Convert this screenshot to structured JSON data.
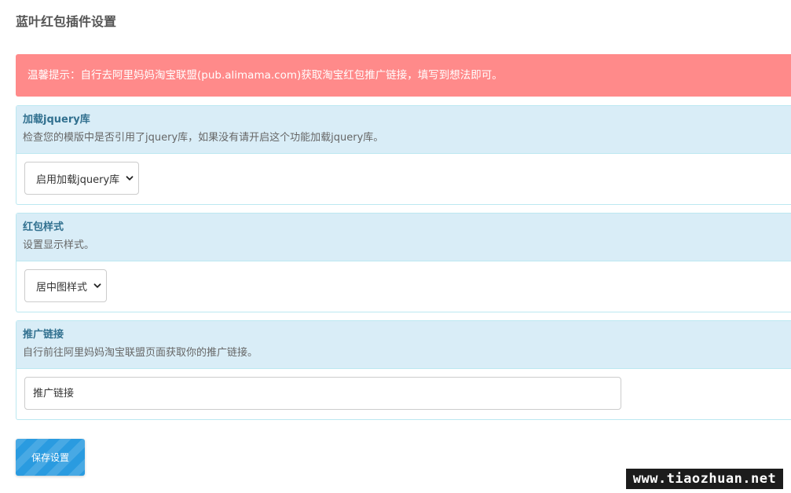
{
  "page": {
    "title": "蓝叶红包插件设置"
  },
  "alert": {
    "text": "温馨提示：自行去阿里妈妈淘宝联盟(pub.alimama.com)获取淘宝红包推广链接，填写到想法即可。"
  },
  "sections": [
    {
      "title": "加载jquery库",
      "description": "检查您的模版中是否引用了jquery库，如果没有请开启这个功能加载jquery库。",
      "control": "select",
      "selected": "启用加载jquery库"
    },
    {
      "title": "红包样式",
      "description": "设置显示样式。",
      "control": "select",
      "selected": "居中图样式"
    },
    {
      "title": "推广链接",
      "description": "自行前往阿里妈妈淘宝联盟页面获取你的推广链接。",
      "control": "text",
      "value": "",
      "placeholder": "推广链接"
    }
  ],
  "save_button": {
    "label": "保存设置"
  },
  "watermark": {
    "text": "www.tiaozhuan.net"
  },
  "colors": {
    "alert_background": "#ff8a8a",
    "panel_heading_background": "#d9edf7",
    "panel_border": "#bce8f1",
    "panel_title": "#31708f",
    "button_background": "#2a9be0"
  },
  "icons": {
    "select_arrow": "chevron-down-icon"
  }
}
